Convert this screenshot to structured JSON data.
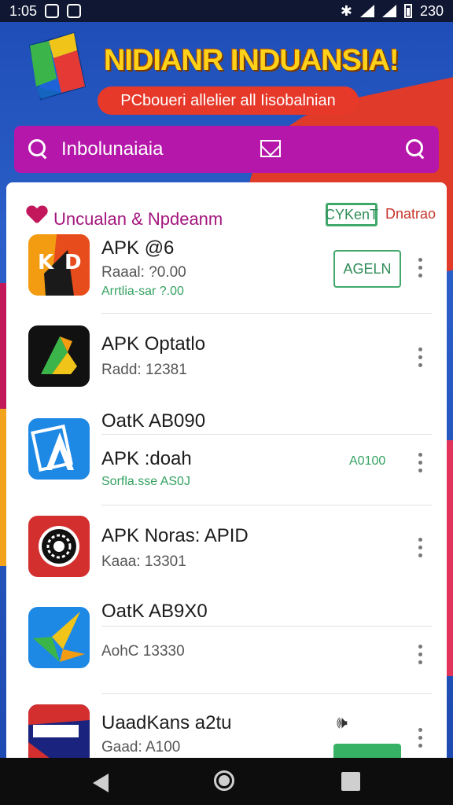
{
  "status_bar": {
    "time": "1:05",
    "time_suffix": "□",
    "battery_text": "230"
  },
  "banner": {
    "title": "NIDIANR INDUANSIA!",
    "subtitle": "PCboueri allelier all Iisobalnian"
  },
  "search": {
    "label": "Inbolunaiaia"
  },
  "section": {
    "title": "Uncualan & Npdeanm",
    "chip": "CYKenT",
    "action": "Dnatrao"
  },
  "apps": [
    {
      "name": "APK @6",
      "meta": "Raaal: ?0.00",
      "sub": "Arrtlia-sar ?.00",
      "button": "AGELN"
    },
    {
      "name": "APK Optatlo",
      "meta": "Radd: 12381"
    },
    {
      "header": "OatK AB090",
      "name": "APK :doah",
      "sub": "Sorfla.sse AS0J",
      "note": "A0100"
    },
    {
      "name": "APK Noras: APID",
      "meta": "Kaaa: 13301"
    },
    {
      "header": "OatK AB9X0",
      "meta": "AohC 13330"
    },
    {
      "name": "UaadKans a2tu",
      "meta": "Gaad: A100"
    }
  ],
  "colors": {
    "search_bg": "#b417a9",
    "accent_green": "#35a161",
    "banner_yellow": "#ffd21a",
    "banner_red": "#e6392a"
  }
}
